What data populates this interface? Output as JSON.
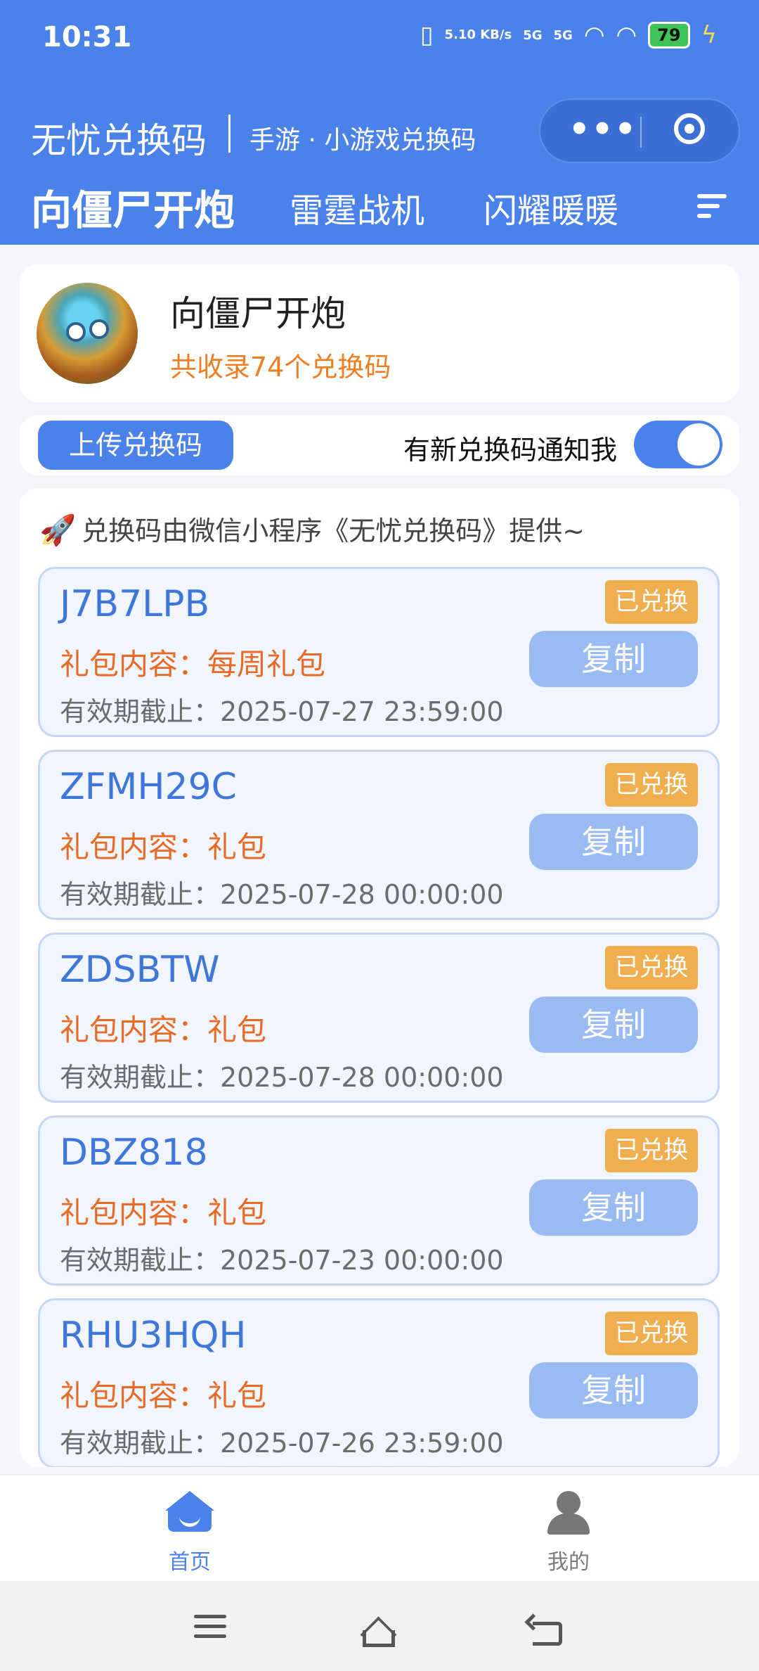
{
  "status_bar": {
    "time": "10:31",
    "network_speed": "5.10\nKB/s",
    "signal_1": "5G",
    "signal_2": "5G",
    "battery": "79",
    "icons": [
      "vibrate-icon",
      "signal-icon",
      "signal-icon",
      "wifi-icon",
      "wifi-icon",
      "battery-icon",
      "charging-icon"
    ]
  },
  "header": {
    "app_title": "无忧兑换码",
    "subtitle": "手游 · 小游戏兑换码",
    "capsule_menu_icon": "more-dots-icon",
    "capsule_close_icon": "target-icon",
    "tabs": [
      {
        "label": "向僵尸开炮"
      },
      {
        "label": "雷霆战机"
      },
      {
        "label": "闪耀暖暖"
      }
    ],
    "menu_icon": "menu-icon"
  },
  "game": {
    "name": "向僵尸开炮",
    "count_text": "共收录74个兑换码"
  },
  "actions": {
    "upload_label": "上传兑换码",
    "notify_label": "有新兑换码通知我",
    "notify_enabled": true
  },
  "list": {
    "provider_text": "兑换码由微信小程序《无忧兑换码》提供~",
    "items": [
      {
        "code": "J7B7LPB",
        "gift": "礼包内容：每周礼包",
        "expiry": "有效期截止：2025-07-27 23:59:00",
        "status": "已兑换",
        "copy": "复制"
      },
      {
        "code": "ZFMH29C",
        "gift": "礼包内容：礼包",
        "expiry": "有效期截止：2025-07-28 00:00:00",
        "status": "已兑换",
        "copy": "复制"
      },
      {
        "code": "ZDSBTW",
        "gift": "礼包内容：礼包",
        "expiry": "有效期截止：2025-07-28 00:00:00",
        "status": "已兑换",
        "copy": "复制"
      },
      {
        "code": "DBZ818",
        "gift": "礼包内容：礼包",
        "expiry": "有效期截止：2025-07-23 00:00:00",
        "status": "已兑换",
        "copy": "复制"
      },
      {
        "code": "RHU3HQH",
        "gift": "礼包内容：礼包",
        "expiry": "有效期截止：2025-07-26 23:59:00",
        "status": "已兑换",
        "copy": "复制"
      }
    ]
  },
  "bottom_nav": {
    "home": "首页",
    "mine": "我的"
  },
  "system_nav": {
    "icons": [
      "menu-icon",
      "home-icon",
      "back-icon"
    ]
  },
  "colors": {
    "primary": "#4b82ea",
    "accent": "#ef7e23",
    "badge": "#f1ae4f",
    "copy_button": "#9abaf2"
  }
}
